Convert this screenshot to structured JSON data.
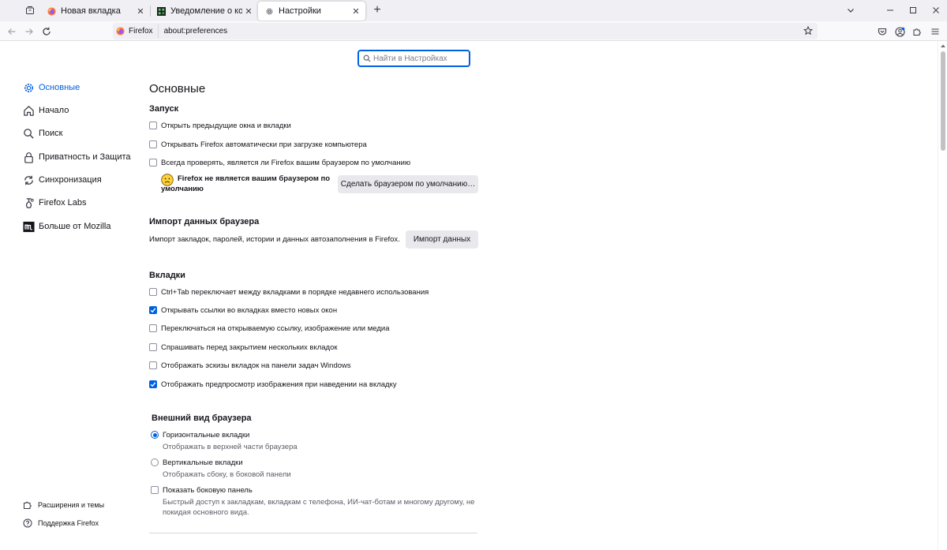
{
  "tabs": [
    {
      "label": "Новая вкладка",
      "icon": "firefox-icon"
    },
    {
      "label": "Уведомление о конфиденциал",
      "icon": "green-block-icon"
    },
    {
      "label": "Настройки",
      "icon": "gear-icon",
      "active": true
    }
  ],
  "nav": {
    "identity_label": "Firefox",
    "url": "about:preferences"
  },
  "search": {
    "placeholder": "Найти в Настройках"
  },
  "sidebar": {
    "categories": [
      {
        "label": "Основные",
        "icon": "gear-icon",
        "active": true
      },
      {
        "label": "Начало",
        "icon": "home-icon"
      },
      {
        "label": "Поиск",
        "icon": "search-icon"
      },
      {
        "label": "Приватность и Защита",
        "icon": "lock-icon"
      },
      {
        "label": "Синхронизация",
        "icon": "sync-icon"
      },
      {
        "label": "Firefox Labs",
        "icon": "labs-icon"
      },
      {
        "label": "Больше от Mozilla",
        "icon": "mozilla-icon"
      }
    ],
    "footer": [
      {
        "label": "Расширения и темы",
        "icon": "puzzle-icon"
      },
      {
        "label": "Поддержка Firefox",
        "icon": "help-icon"
      }
    ]
  },
  "main": {
    "title": "Основные",
    "startup": {
      "heading": "Запуск",
      "options": [
        {
          "label": "Открыть предыдущие окна и вкладки",
          "checked": false
        },
        {
          "label": "Открывать Firefox автоматически при загрузке компьютера",
          "checked": false
        },
        {
          "label": "Всегда проверять, является ли Firefox вашим браузером по умолчанию",
          "checked": false
        }
      ],
      "default_note": "Firefox не является вашим браузером по умолчанию",
      "default_button": "Сделать браузером по умолчанию…"
    },
    "import": {
      "heading": "Импорт данных браузера",
      "description": "Импорт закладок, паролей, истории и данных автозаполнения в Firefox.",
      "button": "Импорт данных"
    },
    "tabs_section": {
      "heading": "Вкладки",
      "options": [
        {
          "label": "Ctrl+Tab переключает между вкладками в порядке недавнего использования",
          "checked": false
        },
        {
          "label": "Открывать ссылки во вкладках вместо новых окон",
          "checked": true
        },
        {
          "label": "Переключаться на открываемую ссылку, изображение или медиа",
          "checked": false
        },
        {
          "label": "Спрашивать перед закрытием нескольких вкладок",
          "checked": false
        },
        {
          "label": "Отображать эскизы вкладок на панели задач Windows",
          "checked": false
        },
        {
          "label": "Отображать предпросмотр изображения при наведении на вкладку",
          "checked": true
        }
      ]
    },
    "appearance": {
      "heading": "Внешний вид браузера",
      "layout_options": [
        {
          "label": "Горизонтальные вкладки",
          "description": "Отображать в верхней части браузера",
          "selected": true
        },
        {
          "label": "Вертикальные вкладки",
          "description": "Отображать сбоку, в боковой панели",
          "selected": false
        }
      ],
      "sidebar_option": {
        "label": "Показать боковую панель",
        "checked": false,
        "description_line1": "Быстрый доступ к закладкам, вкладкам с телефона, ИИ-чат-ботам и многому другому, не",
        "description_line2": "покидая основного вида."
      }
    }
  },
  "colors": {
    "accent": "#0061e0",
    "tabstrip": "#f0f0f4",
    "button": "#e9e9ed"
  }
}
